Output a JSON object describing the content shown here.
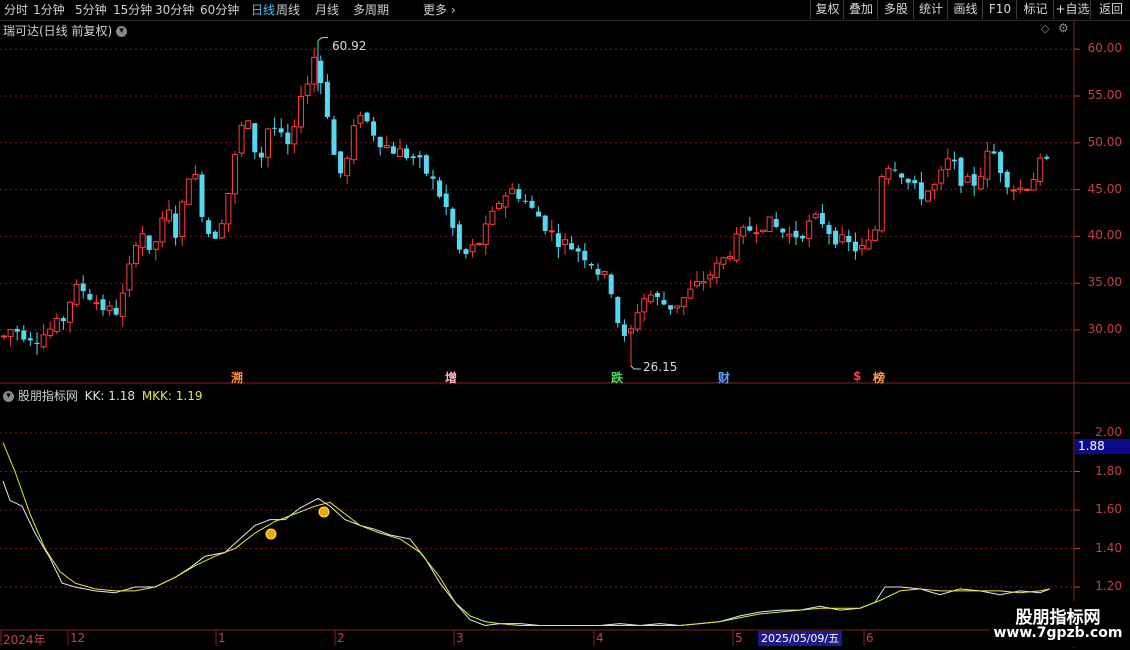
{
  "toolbar": {
    "periods": [
      {
        "label": "分时",
        "active": false
      },
      {
        "label": "1分钟",
        "active": false
      },
      {
        "label": "5分钟",
        "active": false
      },
      {
        "label": "15分钟",
        "active": false
      },
      {
        "label": "30分钟",
        "active": false
      },
      {
        "label": "60分钟",
        "active": false
      },
      {
        "label": "日线",
        "active": true
      },
      {
        "label": "周线",
        "active": false
      },
      {
        "label": "月线",
        "active": false
      },
      {
        "label": "多周期",
        "active": false
      }
    ],
    "more_label": "更多",
    "right_buttons": [
      "复权",
      "叠加",
      "多股",
      "统计",
      "画线",
      "F10",
      "标记",
      "+自选",
      "返回"
    ]
  },
  "main_chart": {
    "title": "瑞可达(日线 前复权)",
    "price_axis": [
      "60.00",
      "55.00",
      "50.00",
      "45.00",
      "40.00",
      "35.00",
      "30.00"
    ],
    "price_ticks": [
      60,
      55,
      50,
      45,
      40,
      35,
      30
    ],
    "high_label": "60.92",
    "low_label": "26.15",
    "event_markers": [
      {
        "label": "溯",
        "color": "#ff8a3d"
      },
      {
        "label": "增",
        "color": "#ffb3c0"
      },
      {
        "label": "跌",
        "color": "#4cd964"
      },
      {
        "label": "财",
        "color": "#5aa0ff"
      },
      {
        "label": "$",
        "color": "#ff4040"
      },
      {
        "label": "榜",
        "color": "#ff9a4a"
      }
    ]
  },
  "indicator": {
    "name": "股朋指标网",
    "kk_label": "KK: 1.18",
    "mkk_label": "MKK: 1.19",
    "axis": [
      "2.00",
      "1.80",
      "1.60",
      "1.40",
      "1.20"
    ],
    "axis_ticks": [
      2.0,
      1.8,
      1.6,
      1.4,
      1.2
    ],
    "current_value": "1.88"
  },
  "date_axis": {
    "labels": [
      "2024年",
      "12",
      "1",
      "2",
      "3",
      "4",
      "5",
      "6"
    ],
    "cursor_date": "2025/05/09/五"
  },
  "watermark": {
    "title": "股朋指标网",
    "url": "www.7gpzb.com"
  },
  "colors": {
    "up": "#ff3b3b",
    "down": "#54d8f0",
    "grid": "#7a1a1a",
    "kk_line": "#e8e8e8",
    "mkk_line": "#e6e640",
    "accent": "#4fc3f7"
  }
}
